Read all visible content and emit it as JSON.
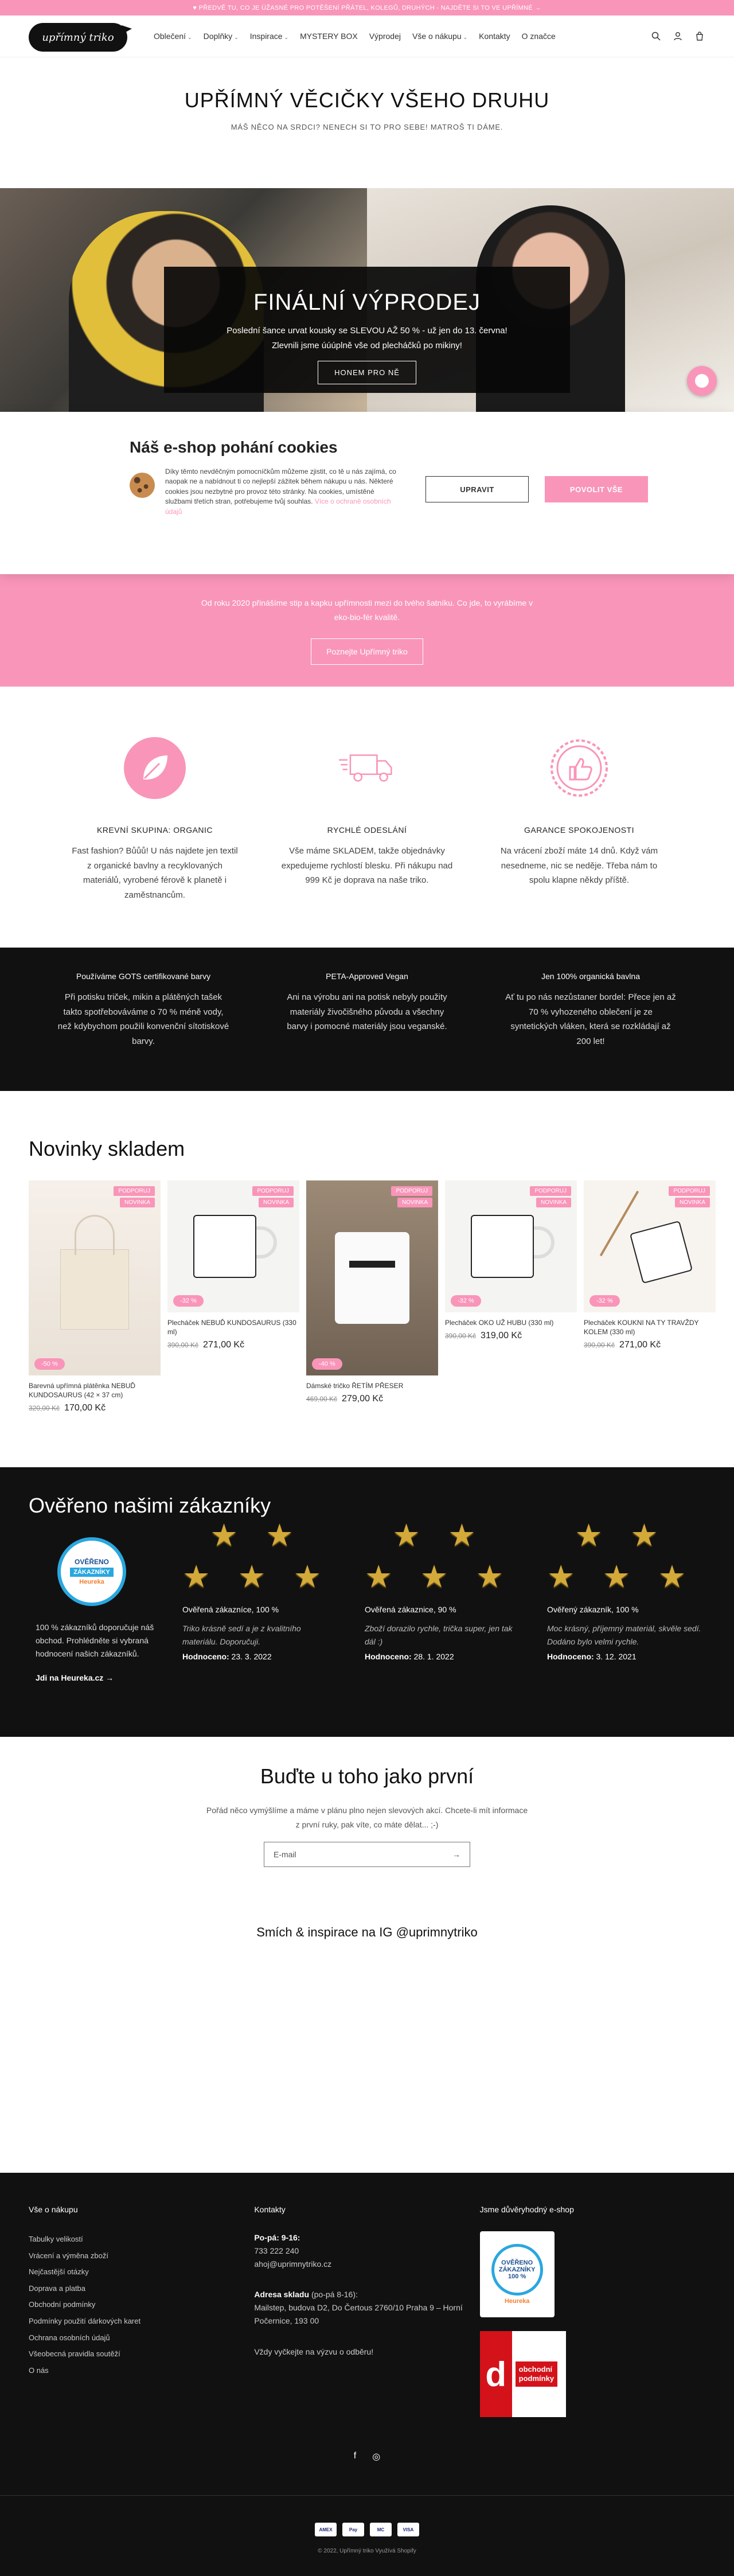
{
  "announcement": "♥ PŘEDVĚ TU, CO JE ÚŽASNÉ PRO POTĚŠENÍ PŘÁTEL, KOLEGŮ, DRUHÝCH - NAJDĚTE SI TO VE UPŘÍMNÉ →",
  "logo_text": "upřímný triko",
  "nav": [
    {
      "label": "Oblečení",
      "caret": true
    },
    {
      "label": "Doplňky",
      "caret": true
    },
    {
      "label": "Inspirace",
      "caret": true
    },
    {
      "label": "MYSTERY BOX",
      "caret": false
    },
    {
      "label": "Výprodej",
      "caret": false
    },
    {
      "label": "Vše o nákupu",
      "caret": true
    },
    {
      "label": "Kontakty",
      "caret": false
    },
    {
      "label": "O značce",
      "caret": false
    }
  ],
  "intro": {
    "title": "UPŘÍMNÝ VĚCIČKY VŠEHO DRUHU",
    "subtitle": "MÁŠ NĚCO NA SRDCI? NENECH SI TO PRO SEBE! MATROŠ TI DÁME."
  },
  "hero": {
    "title": "FINÁLNÍ VÝPRODEJ",
    "line1": "Poslední šance urvat kousky se SLEVOU AŽ 50 % - už jen do 13. června!",
    "line2": "Zlevnili jsme úúúplně vše od plecháčků po mikiny!",
    "button": "HONEM PRO NĚ"
  },
  "cookie": {
    "title": "Náš e-shop pohání cookies",
    "text": "Díky těmto nevděčným pomocníčkům můžeme zjistit, co tě u nás zajímá, co naopak ne a nabídnout ti co nejlepší zážitek během nákupu u nás. Některé cookies jsou nezbytné pro provoz této stránky. Na cookies, umístěné službami třetích stran, potřebujeme tvůj souhlas.",
    "link": "Více o ochraně osobních údajů",
    "accept": "UPRAVIT",
    "allow": "POVOLIT VŠE"
  },
  "pink_band": {
    "text": "Od roku 2020 přinášíme stip a kapku upřímnosti mezi do tvého šatníku. Co jde, to vyrábíme v eko-bio-fér kvalitě.",
    "button": "Poznejte Upřímný triko"
  },
  "features": [
    {
      "title": "KREVNÍ SKUPINA: ORGANIC",
      "text": "Fast fashion? Bůůů! U nás najdete jen textil z organické bavlny a recyklovaných materiálů, vyrobené férově k planetě i zaměstnancům."
    },
    {
      "title": "RYCHLÉ ODESLÁNÍ",
      "text": "Vše máme SKLADEM, takže objednávky expedujeme rychlostí blesku. Při nákupu nad 999 Kč je doprava na naše triko."
    },
    {
      "title": "GARANCE SPOKOJENOSTI",
      "text": "Na vrácení zboží máte 14 dnů. Když vám nesedneme, nic se neděje. Třeba nám to spolu klapne někdy příště."
    }
  ],
  "dark_band": [
    {
      "title": "Používáme GOTS certifikované barvy",
      "text": "Při potisku triček, mikin a plátěných tašek takto spotřebováváme o 70 % méně vody, než kdybychom použili konvenční sítotiskové barvy."
    },
    {
      "title": "PETA-Approved Vegan",
      "text": "Ani na výrobu ani na potisk nebyly použity materiály živočišného původu a všechny barvy i pomocné materiály jsou veganské."
    },
    {
      "title": "Jen 100% organická bavlna",
      "text": "Ať tu po nás nezůstaner bordel: Přece jen až 70 % vyhozeného oblečení je ze syntetických vláken, která se rozkládají až 200 let!"
    }
  ],
  "novinky": {
    "title": "Novinky skladem",
    "products": [
      {
        "name": "Barevná upřímná plátěnka NEBUĎ KUNDOSAURUS (42 × 37 cm)",
        "old": "320,00 Kč",
        "price": "170,00 Kč",
        "sale": "-50 %",
        "badges": [
          "PODPORUJ",
          "NOVINKA"
        ],
        "img": "bag"
      },
      {
        "name": "Plecháček NEBUĎ KUNDOSAURUS (330 ml)",
        "old": "390,00 Kč",
        "price": "271,00 Kč",
        "sale": "-32 %",
        "badges": [
          "PODPORUJ",
          "NOVINKA"
        ],
        "img": "mug"
      },
      {
        "name": "Dámské tričko ŘETÍM PŘESER",
        "old": "469,00 Kč",
        "price": "279,00 Kč",
        "sale": "-40 %",
        "badges": [
          "PODPORUJ",
          "NOVINKA"
        ],
        "img": "shirt"
      },
      {
        "name": "Plecháček OKO UŽ HUBU (330 ml)",
        "old": "390,00 Kč",
        "price": "319,00 Kč",
        "sale": "-32 %",
        "badges": [
          "PODPORUJ",
          "NOVINKA"
        ],
        "img": "mug2"
      },
      {
        "name": "Plecháček KOUKNI NA TY TRAVŽDY KOLEM (330 ml)",
        "old": "390,00 Kč",
        "price": "271,00 Kč",
        "sale": "-32 %",
        "badges": [
          "PODPORUJ",
          "NOVINKA"
        ],
        "img": "mug3"
      }
    ]
  },
  "reviews": {
    "title": "Ověřeno našimi zákazníky",
    "heureka_badge": [
      "OVĚŘENO",
      "ZÁKAZNÍKY",
      "Heureka"
    ],
    "heureka_text": "100 % zákazníků doporučuje náš obchod. Prohlédněte si vybraná hodnocení našich zákazníků.",
    "heureka_link": "Jdi na Heureka.cz →",
    "items": [
      {
        "head": "Ověřená zákazníce, 100 %",
        "text": "Triko krásně sedí a je z kvalitního materiálu. Doporučuji.",
        "label": "Hodnoceno:",
        "date": "23. 3. 2022"
      },
      {
        "head": "Ověřená zákaznice, 90 %",
        "text": "Zboží dorazilo rychle, trička super, jen tak dál :)",
        "label": "Hodnoceno:",
        "date": "28. 1. 2022"
      },
      {
        "head": "Ověřený zákazník, 100 %",
        "text": "Moc krásný, příjemný materiál, skvěle sedí. Dodáno bylo velmi rychle.",
        "label": "Hodnoceno:",
        "date": "3. 12. 2021"
      }
    ]
  },
  "newsletter": {
    "title": "Buďte u toho jako první",
    "text1": "Pořád něco vymýšlíme a máme v plánu plno nejen slevových akcí. Chcete-li mít informace",
    "text2": "z první ruky, pak víte, co máte dělat... ;-)",
    "placeholder": "E-mail"
  },
  "ig_title": "Smích & inspirace na IG @uprimnytriko",
  "footer": {
    "col1_title": "Vše o nákupu",
    "col1_links": [
      "Tabulky velikostí",
      "Vrácení a výměna zboží",
      "Nejčastější otázky",
      "Doprava a platba",
      "Obchodní podmínky",
      "Podmínky použití dárkových karet",
      "Ochrana osobních údajů",
      "Všeobecná pravidla soutěží",
      "O nás"
    ],
    "col2_title": "Kontakty",
    "hours_label": "Po-pá: 9-16:",
    "phone": "733 222 240",
    "email": "ahoj@uprimnytriko.cz",
    "address_label": "Adresa skladu",
    "address_hours": "(po-pá 8-16):",
    "address": "Mailstep, budova D2, Do Čertous 2760/10 Praha 9 – Horní Počernice, 193 00",
    "note": "Vždy vyčkejte na výzvu o odběru!",
    "col3_title": "Jsme důvěryhodný e-shop",
    "trust_heureka": [
      "OVĚŘENO",
      "ZÁKAZNÍKY",
      "100 %",
      "Heureka"
    ],
    "trust_d": [
      "obchodní",
      "podmínky"
    ],
    "social": [
      "f",
      "◎"
    ],
    "payments": [
      "AMEX",
      "Pay",
      "MC",
      "VISA"
    ],
    "copyright": "© 2022, Upřímný triko Využívá Shopify"
  },
  "colors": {
    "accent": "#f995b9",
    "dark": "#111111"
  }
}
